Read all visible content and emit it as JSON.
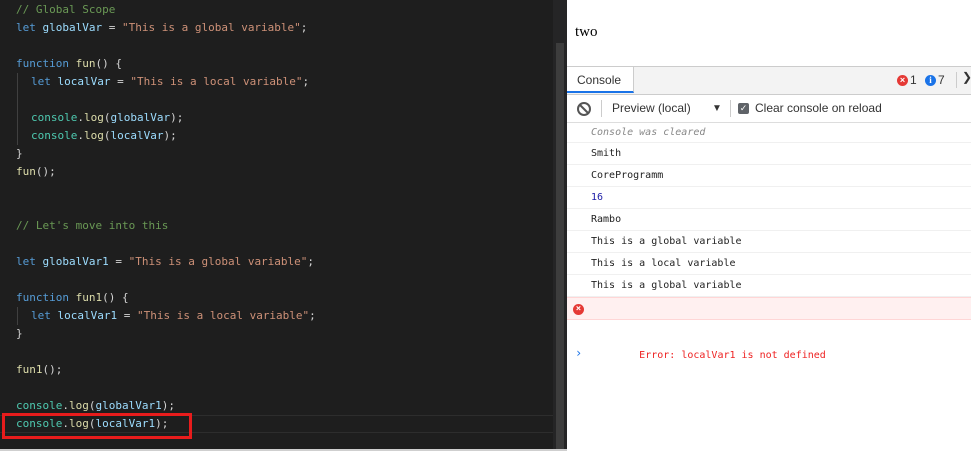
{
  "editor": {
    "comment1": "// Global Scope",
    "comment2": "// Let's move into this",
    "kw_let": "let",
    "kw_function": "function",
    "var_global": "globalVar",
    "var_local": "localVar",
    "var_global1": "globalVar1",
    "var_local1": "localVar1",
    "fn_fun": "fun",
    "fn_fun1": "fun1",
    "str_global": "\"This is a global variable\"",
    "str_local": "\"This is a local variable\"",
    "obj_console": "console",
    "fn_log": "log",
    "eq": " = ",
    "semi": ";",
    "open_params_brace": "() {",
    "close_brace": "}",
    "call": "();",
    "dot": ".",
    "lparen": "(",
    "rparen_semi": ");"
  },
  "page": {
    "line_two": "two"
  },
  "devtools": {
    "tab_console": "Console",
    "error_count": "1",
    "info_count": "7",
    "error_icon_glyph": "×",
    "info_icon_glyph": "i",
    "overflow_glyph": "❯",
    "context": "Preview (local)",
    "context_arrow": "▼",
    "checkbox_glyph": "✓",
    "clear_on_reload": "Clear console on reload",
    "messages": {
      "cleared": "Console was cleared",
      "m1": "Smith",
      "m2": "CoreProgramm",
      "m3": "16",
      "m4": "Rambo",
      "m5": "This is a global variable",
      "m6": "This is a local variable",
      "m7": "This is a global variable",
      "error": "Error: localVar1 is not defined",
      "prompt": "›"
    }
  },
  "colors": {
    "editor_bg": "#1e1e1e",
    "keyword": "#569cd6",
    "string": "#ce9178",
    "comment": "#6a9955",
    "function": "#dcdcaa",
    "variable": "#9cdcfe",
    "highlight_box": "#e81c1c",
    "error_text": "#e22222"
  },
  "icons": [
    "clear-console-icon",
    "error-icon",
    "info-icon",
    "chevron-right-icon",
    "dropdown-arrow-icon",
    "checkbox-checked-icon"
  ]
}
